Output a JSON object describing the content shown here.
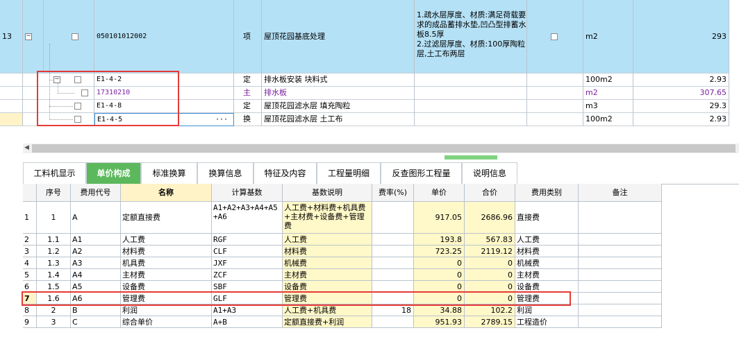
{
  "upper_rows": [
    {
      "no": "13",
      "code": "050101012002",
      "type": "项",
      "name": "屋顶花园基底处理",
      "feature": "1.疏水层厚度、材质:满足荷载要求的成品蓄排水垫,凹凸型排蓄水板8.5厚\n2.过滤层厚度、材质:100厚陶粒层,土工布两层",
      "unit": "m2",
      "qty": "293"
    },
    {
      "code": "E1-4-2",
      "type": "定",
      "name": "排水板安装 块料式",
      "unit": "100m2",
      "qty": "2.93"
    },
    {
      "code": "17310210",
      "type": "主",
      "name": "排水板",
      "unit": "m2",
      "qty": "307.65"
    },
    {
      "code": "E1-4-8",
      "type": "定",
      "name": "屋顶花园滤水层 填充陶粒",
      "unit": "m3",
      "qty": "29.3"
    },
    {
      "code": "E1-4-5",
      "type": "换",
      "name": "屋顶花园滤水层 土工布",
      "unit": "100m2",
      "qty": "2.93",
      "ellipsis": "···"
    }
  ],
  "tabs": [
    "工料机显示",
    "单价构成",
    "标准换算",
    "换算信息",
    "特征及内容",
    "工程量明细",
    "反查图形工程量",
    "说明信息"
  ],
  "headers": [
    "序号",
    "费用代号",
    "名称",
    "计算基数",
    "基数说明",
    "费率(%)",
    "单价",
    "合价",
    "费用类别",
    "备注"
  ],
  "rows": [
    {
      "n": "1",
      "seq": "1",
      "code": "A",
      "name": "定额直接费",
      "base": "A1+A2+A3+A4+A5+A6",
      "desc": "人工费+材料费+机具费+主材费+设备费+管理费",
      "rate": "",
      "price": "917.05",
      "total": "2686.96",
      "cat": "直接费"
    },
    {
      "n": "2",
      "seq": "1.1",
      "code": "A1",
      "name": "人工费",
      "base": "RGF",
      "desc": "人工费",
      "rate": "",
      "price": "193.8",
      "total": "567.83",
      "cat": "人工费"
    },
    {
      "n": "3",
      "seq": "1.2",
      "code": "A2",
      "name": "材料费",
      "base": "CLF",
      "desc": "材料费",
      "rate": "",
      "price": "723.25",
      "total": "2119.12",
      "cat": "材料费"
    },
    {
      "n": "4",
      "seq": "1.3",
      "code": "A3",
      "name": "机具费",
      "base": "JXF",
      "desc": "机械费",
      "rate": "",
      "price": "0",
      "total": "0",
      "cat": "机械费"
    },
    {
      "n": "5",
      "seq": "1.4",
      "code": "A4",
      "name": "主材费",
      "base": "ZCF",
      "desc": "主材费",
      "rate": "",
      "price": "0",
      "total": "0",
      "cat": "主材费"
    },
    {
      "n": "6",
      "seq": "1.5",
      "code": "A5",
      "name": "设备费",
      "base": "SBF",
      "desc": "设备费",
      "rate": "",
      "price": "0",
      "total": "0",
      "cat": "设备费"
    },
    {
      "n": "7",
      "seq": "1.6",
      "code": "A6",
      "name": "管理费",
      "base": "GLF",
      "desc": "管理费",
      "rate": "",
      "price": "0",
      "total": "0",
      "cat": "管理费"
    },
    {
      "n": "8",
      "seq": "2",
      "code": "B",
      "name": "利润",
      "base": "A1+A3",
      "desc": "人工费+机具费",
      "rate": "18",
      "price": "34.88",
      "total": "102.2",
      "cat": "利润"
    },
    {
      "n": "9",
      "seq": "3",
      "code": "C",
      "name": "综合单价",
      "base": "A+B",
      "desc": "定额直接费+利润",
      "rate": "",
      "price": "951.93",
      "total": "2789.15",
      "cat": "工程造价"
    }
  ]
}
